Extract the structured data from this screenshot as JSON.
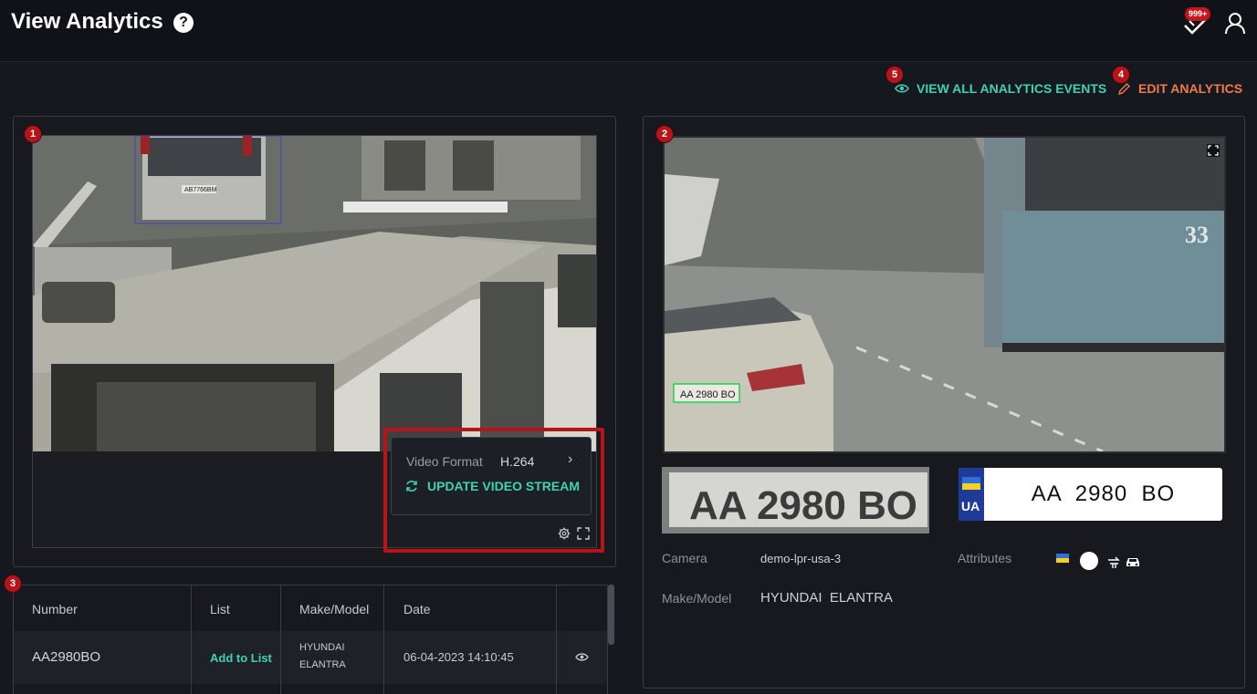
{
  "header": {
    "title": "View Analytics",
    "help_glyph": "?",
    "notification_count": "999+"
  },
  "actions": {
    "view_all": "VIEW ALL ANALYTICS EVENTS",
    "edit": "EDIT ANALYTICS",
    "view_all_color": "#3fd1b2",
    "edit_color": "#f07a4a"
  },
  "markers": [
    "1",
    "2",
    "3",
    "4",
    "5"
  ],
  "video_panel": {
    "format_label": "Video Format",
    "format_value": "H.264",
    "update_stream": "UPDATE VIDEO STREAM",
    "scene_plate_text": "AB7766BM"
  },
  "table": {
    "headers": [
      "Number",
      "List",
      "Make/Model",
      "Date"
    ],
    "rows": [
      {
        "number": "AA2980BO",
        "list_action": "Add to List",
        "make": "HYUNDAI",
        "model": "ELANTRA",
        "date": "06-04-2023 14:10:45"
      }
    ]
  },
  "detail": {
    "scene_plate_text": "AA 2980 BO",
    "scene_bus_number": "33",
    "crop_plate_text": "AA 2980 BO",
    "plate_number": "AA  2980  BO",
    "plate_country": "UA",
    "camera_label": "Camera",
    "camera_value": "demo-lpr-usa-3",
    "attributes_label": "Attributes",
    "make_model_label": "Make/Model",
    "make_model_value": "HYUNDAI  ELANTRA"
  },
  "icons": {
    "help": "question-circle-icon",
    "notifications": "notification-check-icon",
    "user": "user-icon",
    "view": "eye-icon",
    "edit": "pencil-icon",
    "update": "refresh-icon",
    "settings": "gear-icon",
    "fullscreen": "expand-icon"
  }
}
